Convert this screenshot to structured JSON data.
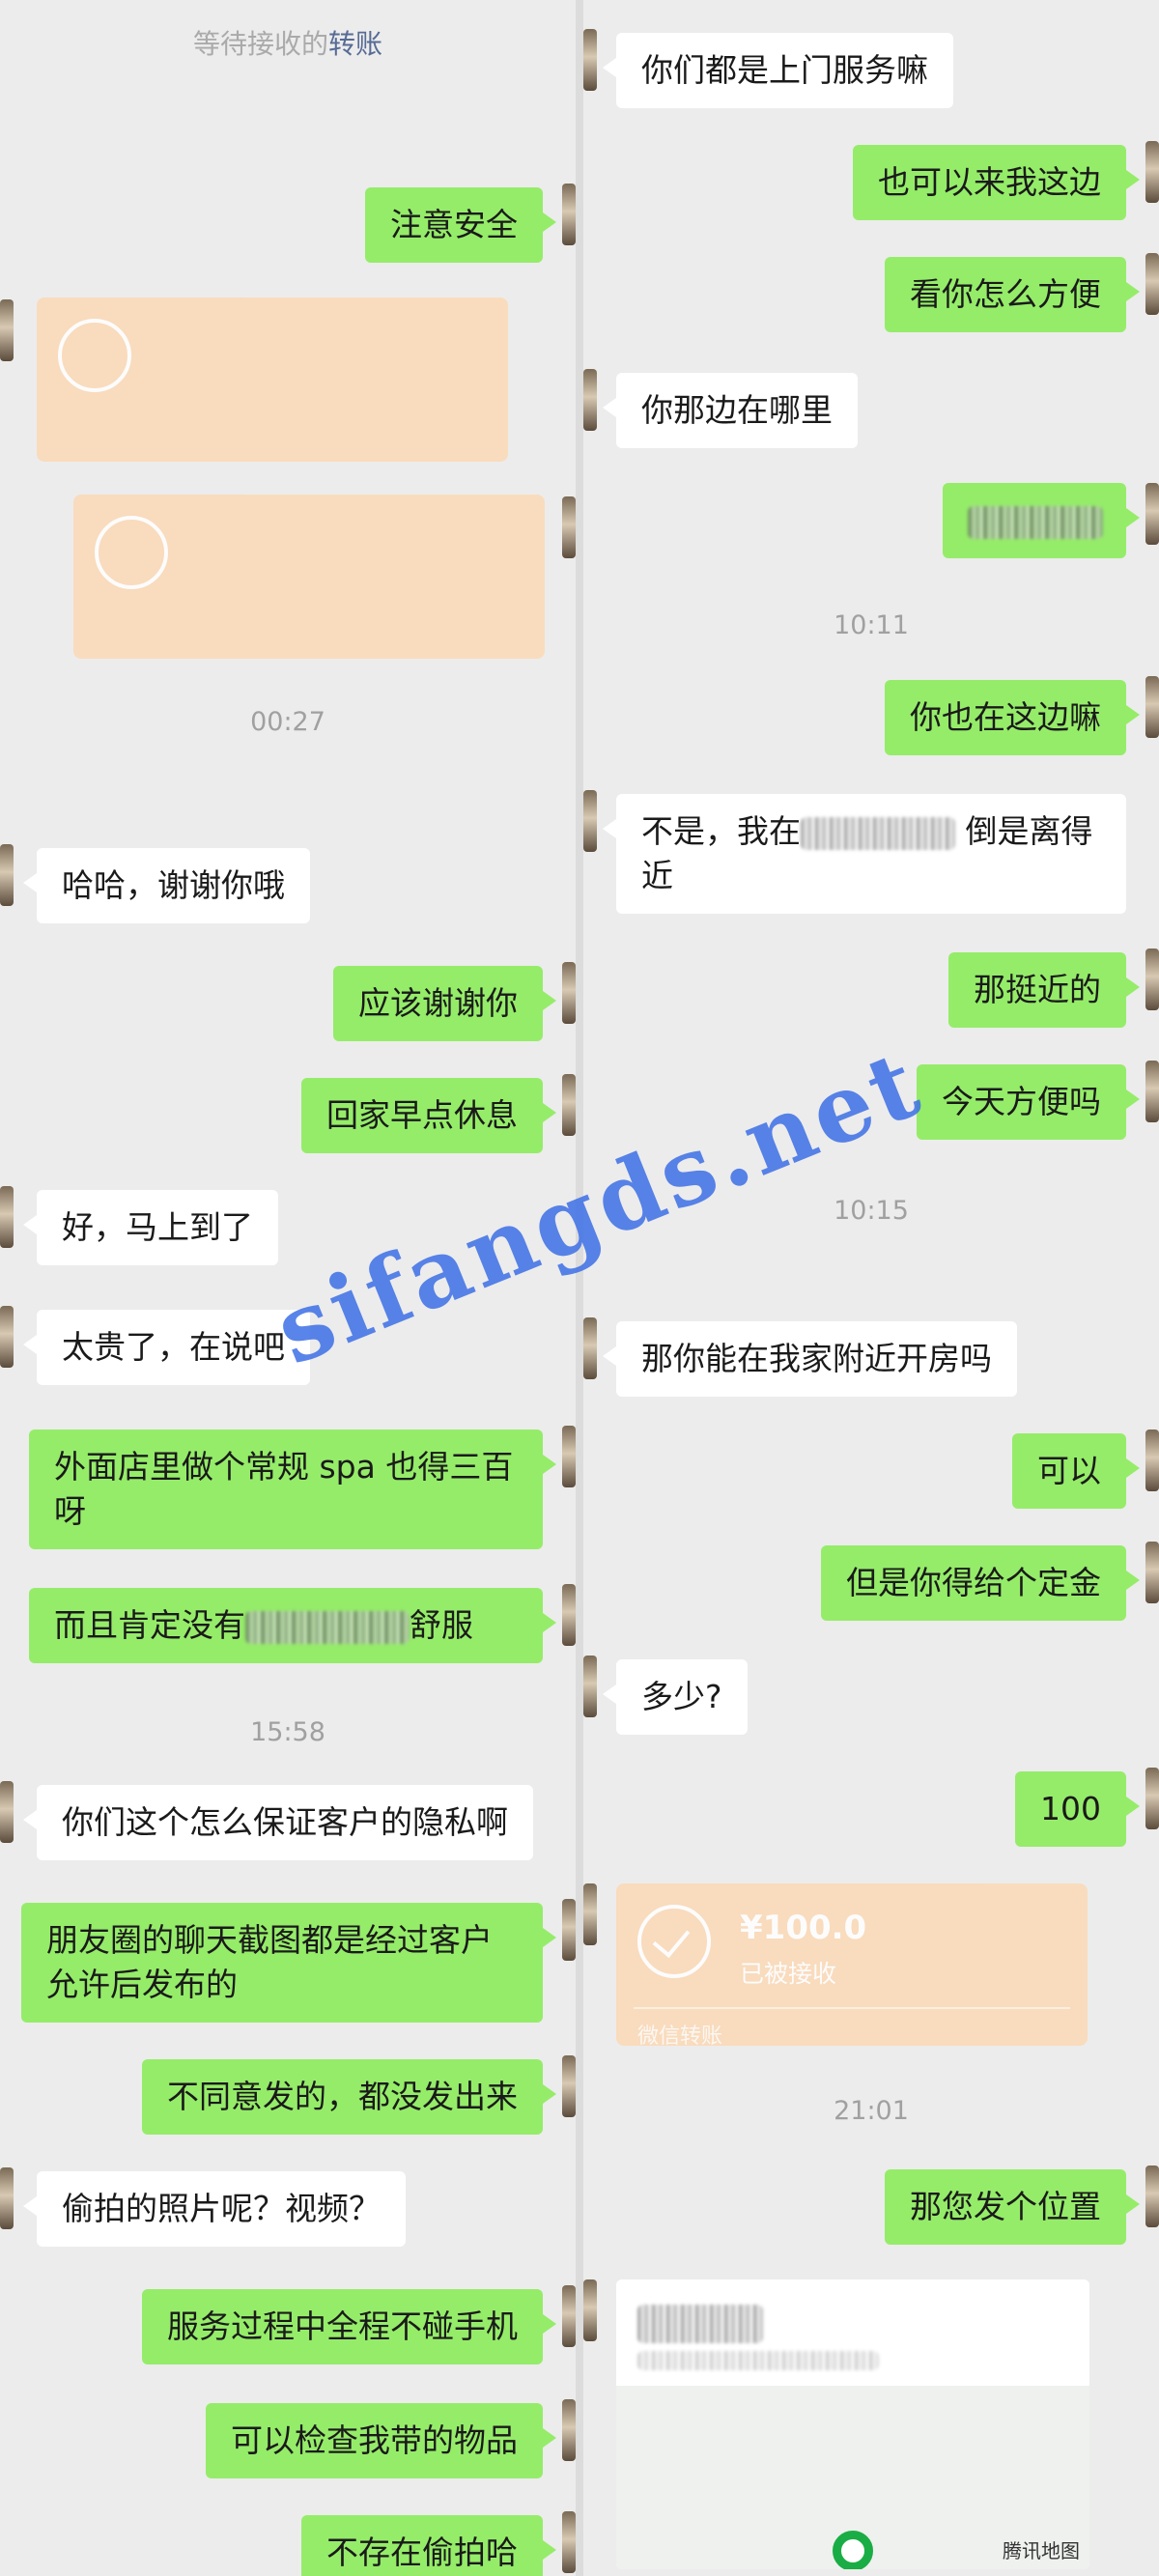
{
  "left": {
    "top_note_prefix": "等待接收的",
    "top_note_link": "转账",
    "messages": {
      "m1": "注意安全",
      "m2": "哈哈，谢谢你哦",
      "m3": "应该谢谢你",
      "m4": "回家早点休息",
      "m5": "好，马上到了",
      "m6": "太贵了，在说吧",
      "m7": "外面店里做个常规 spa 也得三百呀",
      "m8_prefix": "而且肯定没有",
      "m8_suffix": "舒服",
      "m9": "你们这个怎么保证客户的隐私啊",
      "m10": "朋友圈的聊天截图都是经过客户允许后发布的",
      "m11": "不同意发的，都没发出来",
      "m12": "偷拍的照片呢？视频？",
      "m13": "服务过程中全程不碰手机",
      "m14": "可以检查我带的物品",
      "m15": "不存在偷拍哈"
    },
    "timestamps": {
      "t1": "00:27",
      "t2": "15:58"
    }
  },
  "right": {
    "messages": {
      "r1": "你们都是上门服务嘛",
      "r2": "也可以来我这边",
      "r3": "看你怎么方便",
      "r4": "你那边在哪里",
      "r5": "你也在这边嘛",
      "r6_prefix": "不是，我在",
      "r6_suffix": "倒是离得近",
      "r7": "那挺近的",
      "r8": "今天方便吗",
      "r9": "那你能在我家附近开房吗",
      "r10": "可以",
      "r11": "但是你得给个定金",
      "r12": "多少?",
      "r13": "100",
      "r14": "那您发个位置"
    },
    "timestamps": {
      "t1": "10:11",
      "t2": "10:15",
      "t3": "21:01"
    },
    "transfer": {
      "amount": "¥100.0",
      "status": "已被接收",
      "footer": "微信转账"
    },
    "map_label": "腾讯地图"
  },
  "watermark": "sifangds.net"
}
